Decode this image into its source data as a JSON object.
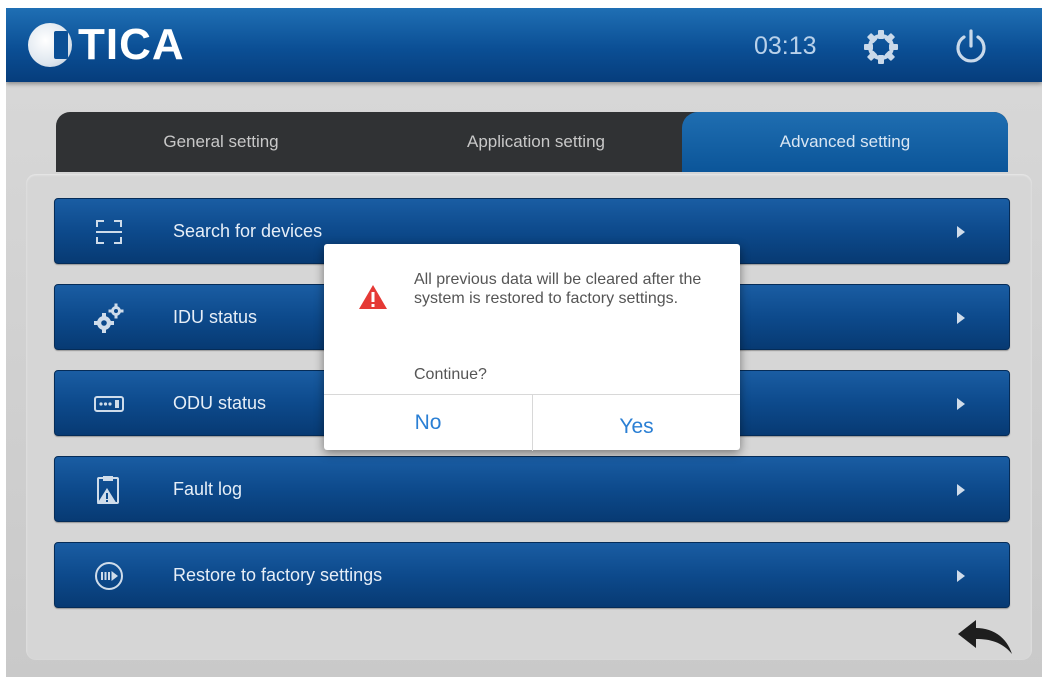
{
  "header": {
    "brand": "TICA",
    "time": "03:13"
  },
  "tabs": [
    {
      "label": "General setting"
    },
    {
      "label": "Application setting"
    },
    {
      "label": "Advanced setting",
      "active": true
    }
  ],
  "menu": {
    "items": [
      {
        "label": "Search for devices",
        "icon": "scan-icon"
      },
      {
        "label": "IDU status",
        "icon": "gears-icon"
      },
      {
        "label": "ODU status",
        "icon": "outdoor-unit-icon"
      },
      {
        "label": "Fault log",
        "icon": "fault-log-icon"
      },
      {
        "label": "Restore to factory settings",
        "icon": "restore-icon"
      }
    ]
  },
  "dialog": {
    "message": "All previous data will be cleared after the system is restored to factory settings.",
    "confirm": "Continue?",
    "no_label": "No",
    "yes_label": "Yes"
  },
  "colors": {
    "header_blue": "#0b4f95",
    "button_blue": "#2a7fd4",
    "warning_red": "#e53935"
  }
}
